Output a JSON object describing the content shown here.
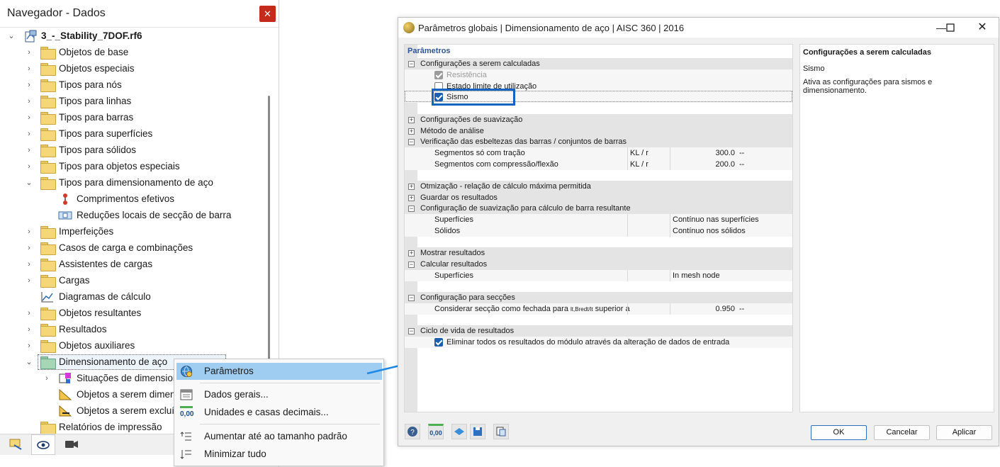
{
  "navigator": {
    "title": "Navegador - Dados",
    "close_icon": "✕",
    "root": "3_-_Stability_7DOF.rf6",
    "items": [
      {
        "label": "Objetos de base"
      },
      {
        "label": "Objetos especiais"
      },
      {
        "label": "Tipos para nós"
      },
      {
        "label": "Tipos para linhas"
      },
      {
        "label": "Tipos para barras"
      },
      {
        "label": "Tipos para superfícies"
      },
      {
        "label": "Tipos para sólidos"
      },
      {
        "label": "Tipos para objetos especiais"
      },
      {
        "label": "Tipos para dimensionamento de aço"
      },
      {
        "label": "Comprimentos efetivos"
      },
      {
        "label": "Reduções locais de secção de barra"
      },
      {
        "label": "Imperfeições"
      },
      {
        "label": "Casos de carga e combinações"
      },
      {
        "label": "Assistentes de cargas"
      },
      {
        "label": "Cargas"
      },
      {
        "label": "Diagramas de cálculo"
      },
      {
        "label": "Objetos resultantes"
      },
      {
        "label": "Resultados"
      },
      {
        "label": "Objetos auxiliares"
      },
      {
        "label": "Dimensionamento de aço"
      },
      {
        "label": "Situações de dimension"
      },
      {
        "label": "Objetos a serem dimen"
      },
      {
        "label": "Objetos a serem excluí"
      },
      {
        "label": "Relatórios de impressão"
      }
    ]
  },
  "context_menu": {
    "items": [
      {
        "label": "Parâmetros"
      },
      {
        "label": "Dados gerais..."
      },
      {
        "label": "Unidades e casas decimais..."
      },
      {
        "label": "Aumentar até ao tamanho padrão"
      },
      {
        "label": "Minimizar tudo"
      }
    ],
    "units_icon_text": "0,00"
  },
  "dialog": {
    "title": "Parâmetros globais | Dimensionamento de aço | AISC 360 | 2016",
    "params_header": "Parâmetros",
    "rows": {
      "s1": "Configurações a serem calculadas",
      "resistencia": "Resistência",
      "estado": "Estado limite de utilização",
      "sismo": "Sismo",
      "s2": "Configurações de suavização",
      "s3": "Método de análise",
      "s4": "Verificação das esbeltezas das barras / conjuntos de barras",
      "seg1": "Segmentos só com tração",
      "seg1_sym": "KL / r",
      "seg1_val": "300.0",
      "seg1_unit": "--",
      "seg2": "Segmentos com compressão/flexão",
      "seg2_sym": "KL / r",
      "seg2_val": "200.0",
      "seg2_unit": "--",
      "s5": "Otmização - relação de cálculo máxima permitida",
      "s6": "Guardar os resultados",
      "s7": "Configuração de suavização para cálculo de barra resultante",
      "sup": "Superfícies",
      "sup_val": "Contínuo nas superfícies",
      "sol": "Sólidos",
      "sol_val": "Contínuo nos sólidos",
      "s8": "Mostrar resultados",
      "s9": "Calcular resultados",
      "sup2": "Superfícies",
      "sup2_val": "In mesh node",
      "s10": "Configuração para secções",
      "consid": "Considerar secção como fechada para",
      "consid_sub": "lt,Bredt/lt",
      "consid_tail": "superior a",
      "consid_val": "0.950",
      "consid_unit": "--",
      "s11": "Ciclo de vida de resultados",
      "elim": "Eliminar todos os resultados do módulo através da alteração de dados de entrada"
    },
    "description": {
      "title": "Configurações a serem calculadas",
      "name": "Sismo",
      "text": "Ativa as configurações para sismos e dimensionamento."
    },
    "toolbar_units": "0,00",
    "buttons": {
      "ok": "OK",
      "cancel": "Cancelar",
      "apply": "Aplicar"
    }
  }
}
